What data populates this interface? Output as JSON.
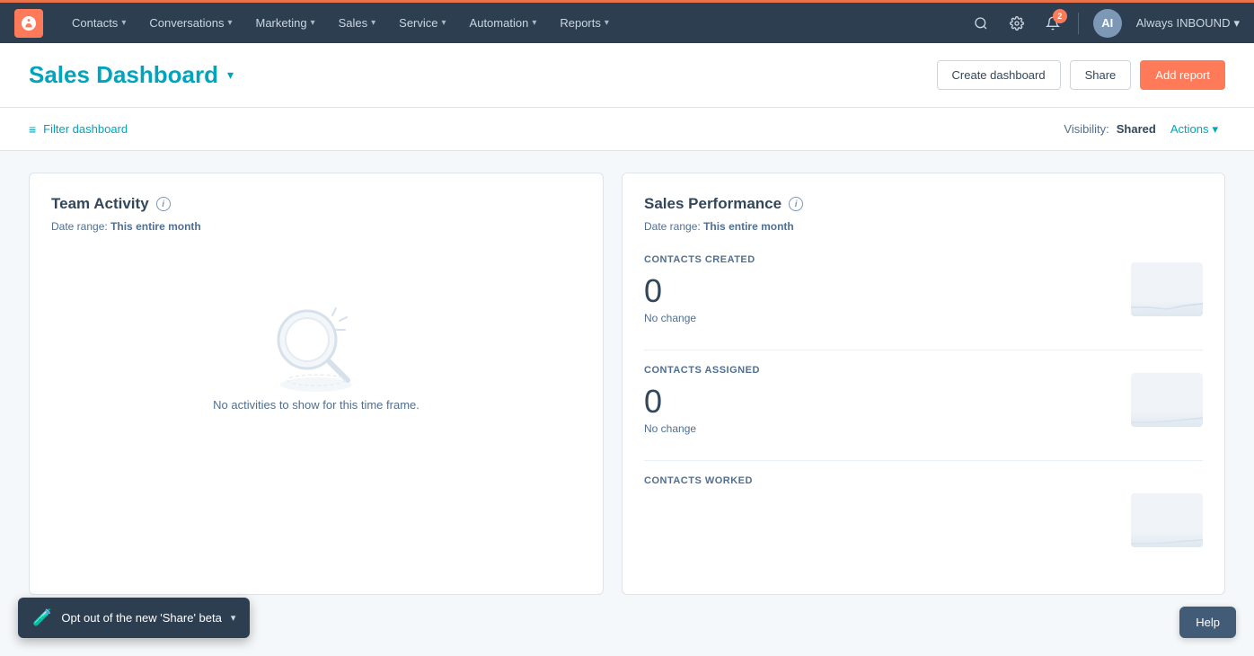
{
  "topnav": {
    "logo_alt": "HubSpot logo",
    "items": [
      {
        "label": "Contacts",
        "id": "contacts"
      },
      {
        "label": "Conversations",
        "id": "conversations"
      },
      {
        "label": "Marketing",
        "id": "marketing"
      },
      {
        "label": "Sales",
        "id": "sales"
      },
      {
        "label": "Service",
        "id": "service"
      },
      {
        "label": "Automation",
        "id": "automation"
      },
      {
        "label": "Reports",
        "id": "reports"
      }
    ],
    "notification_count": "2",
    "user_label": "Always INBOUND",
    "user_avatar_initials": "AI"
  },
  "header": {
    "title": "Sales Dashboard",
    "create_dashboard_label": "Create dashboard",
    "share_label": "Share",
    "add_report_label": "Add report"
  },
  "filter_bar": {
    "filter_label": "Filter dashboard",
    "visibility_label": "Visibility:",
    "visibility_value": "Shared",
    "actions_label": "Actions"
  },
  "team_activity_card": {
    "title": "Team Activity",
    "date_range_prefix": "Date range:",
    "date_range_value": "This entire month",
    "empty_text": "No activities to show for this time frame."
  },
  "sales_performance_card": {
    "title": "Sales Performance",
    "date_range_prefix": "Date range:",
    "date_range_value": "This entire month",
    "metrics": [
      {
        "label": "CONTACTS CREATED",
        "value": "0",
        "change": "No change"
      },
      {
        "label": "CONTACTS ASSIGNED",
        "value": "0",
        "change": "No change"
      },
      {
        "label": "CONTACTS WORKED",
        "value": null,
        "change": null
      }
    ]
  },
  "beta_banner": {
    "icon": "🧪",
    "text": "Opt out of the new 'Share' beta"
  },
  "help_button": {
    "label": "Help"
  }
}
